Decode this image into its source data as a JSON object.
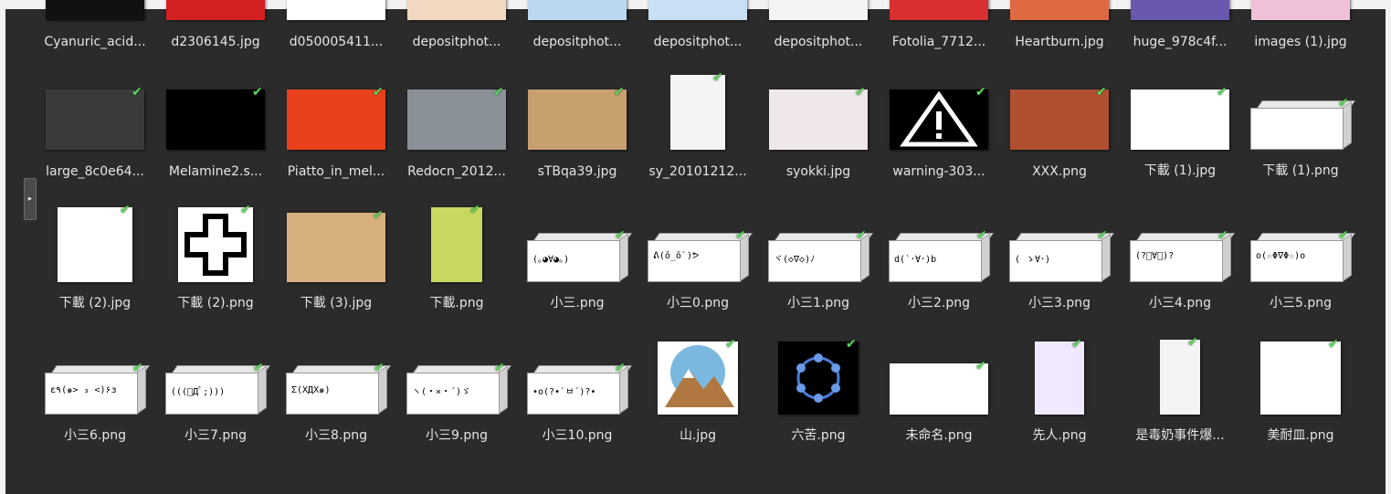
{
  "rows": [
    {
      "items": [
        {
          "name": "Cyanuric_acid...",
          "kind": "partial",
          "color": "#111111"
        },
        {
          "name": "d2306145.jpg",
          "kind": "partial",
          "color": "#d32020"
        },
        {
          "name": "d050005411...",
          "kind": "partial",
          "color": "#ffffff"
        },
        {
          "name": "depositphot...",
          "kind": "partial",
          "color": "#f2d8c0"
        },
        {
          "name": "depositphot...",
          "kind": "partial",
          "color": "#bcd8f0"
        },
        {
          "name": "depositphot...",
          "kind": "partial",
          "color": "#c8dff4"
        },
        {
          "name": "depositphot...",
          "kind": "partial",
          "color": "#f4f4f4"
        },
        {
          "name": "Fotolia_7712...",
          "kind": "partial",
          "color": "#d83030"
        },
        {
          "name": "Heartburn.jpg",
          "kind": "partial",
          "color": "#e06a40"
        },
        {
          "name": "huge_978c4f...",
          "kind": "partial",
          "color": "#6a58b0"
        },
        {
          "name": "images (1).jpg",
          "kind": "partial",
          "color": "#f0c0d8"
        }
      ]
    },
    {
      "items": [
        {
          "name": "large_8c0e64...",
          "kind": "photo",
          "color": "#3a3a3a"
        },
        {
          "name": "Melamine2.s...",
          "kind": "photo",
          "color": "#000000"
        },
        {
          "name": "Piatto_in_mel...",
          "kind": "photo",
          "color": "#e8401c"
        },
        {
          "name": "Redocn_2012...",
          "kind": "photo",
          "color": "#8a9098"
        },
        {
          "name": "sTBqa39.jpg",
          "kind": "photo",
          "color": "#c8a070"
        },
        {
          "name": "sy_20101212...",
          "kind": "photo",
          "color": "#f4f4f4"
        },
        {
          "name": "syokki.jpg",
          "kind": "photo",
          "color": "#f0e8e8"
        },
        {
          "name": "warning-303...",
          "kind": "warning",
          "color": "#000000"
        },
        {
          "name": "XXX.png",
          "kind": "photo",
          "color": "#b05030"
        },
        {
          "name": "下載 (1).jpg",
          "kind": "photo",
          "color": "#ffffff"
        },
        {
          "name": "下載 (1).png",
          "kind": "box",
          "emote": ""
        }
      ]
    },
    {
      "items": [
        {
          "name": "下載 (2).jpg",
          "kind": "photo",
          "color": "#ffffff"
        },
        {
          "name": "下載 (2).png",
          "kind": "cross",
          "color": "#ffffff"
        },
        {
          "name": "下載 (3).jpg",
          "kind": "photo",
          "color": "#d8b080"
        },
        {
          "name": "下載.png",
          "kind": "photo",
          "color": "#c8d860"
        },
        {
          "name": "小三.png",
          "kind": "box",
          "emote": "(｡◕∀◕｡)"
        },
        {
          "name": "小三0.png",
          "kind": "box",
          "emote": "ᕕ(ō_ō`)ᕗ"
        },
        {
          "name": "小三1.png",
          "kind": "box",
          "emote": "ヾ(◇∇◇)ﾉ"
        },
        {
          "name": "小三2.png",
          "kind": "box",
          "emote": "d(`･∀･)b"
        },
        {
          "name": "小三3.png",
          "kind": "box",
          "emote": "( ゝ∀･)"
        },
        {
          "name": "小三4.png",
          "kind": "box",
          "emote": "(?ﾟ∀ﾟ)?"
        },
        {
          "name": "小三5.png",
          "kind": "box",
          "emote": "o(☆Φ∇Φ☆)o"
        }
      ]
    },
    {
      "items": [
        {
          "name": "小三6.png",
          "kind": "box",
          "emote": "ε٩(๑> ₃ <)۶з"
        },
        {
          "name": "小三7.png",
          "kind": "box",
          "emote": "(((ﾟДﾟ;)))"
        },
        {
          "name": "小三8.png",
          "kind": "box",
          "emote": "Σ(ΧДΧ๑)"
        },
        {
          "name": "小三9.png",
          "kind": "box",
          "emote": "ヽ(・×・´)ゞ"
        },
        {
          "name": "小三10.png",
          "kind": "box",
          "emote": "•o(?•`ㅂ´)?•"
        },
        {
          "name": "山.jpg",
          "kind": "photo",
          "color": "#7ab8e0"
        },
        {
          "name": "六苦.png",
          "kind": "photo",
          "color": "#000000"
        },
        {
          "name": "未命名.png",
          "kind": "photo",
          "color": "#ffffff"
        },
        {
          "name": "先人.png",
          "kind": "photo",
          "color": "#f0e8ff"
        },
        {
          "name": "是毒奶事件爆...",
          "kind": "photo",
          "color": "#f4f4f4"
        },
        {
          "name": "美耐皿.png",
          "kind": "photo",
          "color": "#ffffff"
        }
      ]
    }
  ],
  "panel_toggle_icon": "chevron-right-icon",
  "check_icon": "check-icon"
}
